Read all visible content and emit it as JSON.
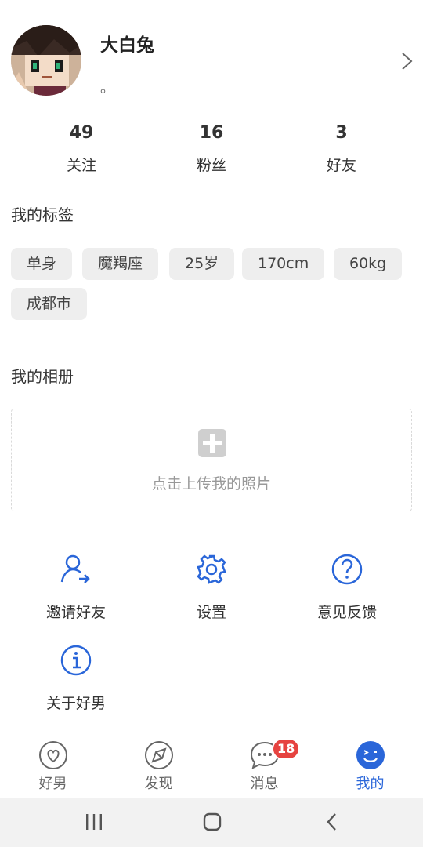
{
  "profile": {
    "username": "大白兔",
    "signature": "。"
  },
  "stats": [
    {
      "value": "49",
      "label": "关注"
    },
    {
      "value": "16",
      "label": "粉丝"
    },
    {
      "value": "3",
      "label": "好友"
    }
  ],
  "tags_section": {
    "title": "我的标签",
    "tags": [
      "单身",
      "魔羯座",
      "25岁",
      "170cm",
      "60kg",
      "成都市"
    ]
  },
  "album_section": {
    "title": "我的相册",
    "upload_hint": "点击上传我的照片"
  },
  "menu": [
    {
      "label": "邀请好友",
      "icon": "invite-user-icon"
    },
    {
      "label": "设置",
      "icon": "gear-icon"
    },
    {
      "label": "意见反馈",
      "icon": "question-icon"
    },
    {
      "label": "关于好男",
      "icon": "info-icon"
    }
  ],
  "tabbar": {
    "tabs": [
      {
        "label": "好男",
        "icon": "heart-icon"
      },
      {
        "label": "发现",
        "icon": "compass-icon"
      },
      {
        "label": "消息",
        "icon": "chat-icon",
        "badge": "18"
      },
      {
        "label": "我的",
        "icon": "smiley-icon",
        "active": true
      }
    ]
  },
  "colors": {
    "accent": "#2a66d9",
    "badge": "#e64340",
    "tag_bg": "#eeeeee",
    "text_primary": "#222222",
    "text_muted": "#999999"
  }
}
